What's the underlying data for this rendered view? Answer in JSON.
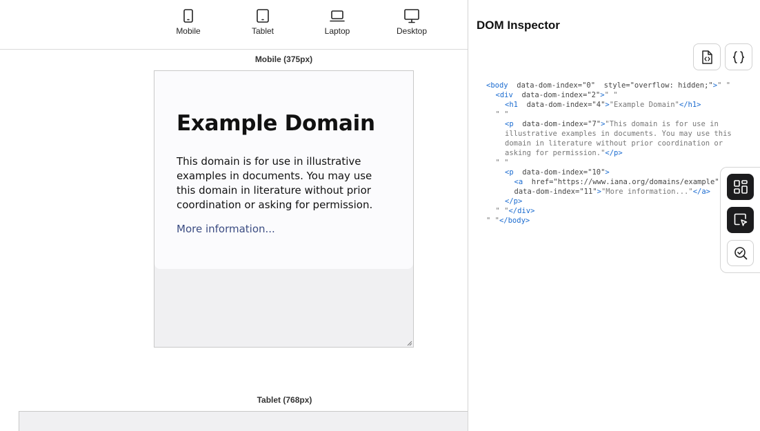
{
  "devices": [
    {
      "label": "Mobile",
      "icon": "mobile-icon"
    },
    {
      "label": "Tablet",
      "icon": "tablet-icon"
    },
    {
      "label": "Laptop",
      "icon": "laptop-icon"
    },
    {
      "label": "Desktop",
      "icon": "desktop-icon"
    }
  ],
  "preview": {
    "mobile_label": "Mobile (375px)",
    "tablet_label": "Tablet (768px)",
    "page": {
      "heading": "Example Domain",
      "body": "This domain is for use in illustrative examples in documents. You may use this domain in literature without prior coordination or asking for permission.",
      "link_text": "More information..."
    }
  },
  "inspector": {
    "title": "DOM Inspector",
    "view_source_icon": "file-code-icon",
    "json_icon": "braces-icon",
    "lines": [
      {
        "indent": 0,
        "parts": [
          [
            "tag",
            "<body"
          ],
          [
            "attr",
            "  data-dom-index=\"0\"  style=\"overflow: hidden;\""
          ],
          [
            "tag",
            ">"
          ],
          [
            "str",
            "\" \""
          ]
        ]
      },
      {
        "indent": 1,
        "parts": [
          [
            "tag",
            "<div"
          ],
          [
            "attr",
            "  data-dom-index=\"2\""
          ],
          [
            "tag",
            ">"
          ],
          [
            "str",
            "\" \""
          ]
        ]
      },
      {
        "indent": 2,
        "parts": [
          [
            "tag",
            "<h1"
          ],
          [
            "attr",
            "  data-dom-index=\"4\""
          ],
          [
            "tag",
            ">"
          ],
          [
            "str",
            "\"Example Domain\""
          ],
          [
            "tag",
            "</h1>"
          ]
        ]
      },
      {
        "indent": 1,
        "parts": [
          [
            "str",
            "\" \""
          ]
        ]
      },
      {
        "indent": 2,
        "parts": [
          [
            "tag",
            "<p"
          ],
          [
            "attr",
            "  data-dom-index=\"7\""
          ],
          [
            "tag",
            ">"
          ],
          [
            "str",
            "\"This domain is for use in"
          ]
        ]
      },
      {
        "indent": 2,
        "parts": [
          [
            "str",
            "illustrative examples in documents. You may use this"
          ]
        ]
      },
      {
        "indent": 2,
        "parts": [
          [
            "str",
            "domain in literature without prior coordination or"
          ]
        ]
      },
      {
        "indent": 2,
        "parts": [
          [
            "str",
            "asking for permission.\""
          ],
          [
            "tag",
            "</p>"
          ]
        ]
      },
      {
        "indent": 1,
        "parts": [
          [
            "str",
            "\" \""
          ]
        ]
      },
      {
        "indent": 2,
        "parts": [
          [
            "tag",
            "<p"
          ],
          [
            "attr",
            "  data-dom-index=\"10\""
          ],
          [
            "tag",
            ">"
          ]
        ]
      },
      {
        "indent": 3,
        "parts": [
          [
            "tag",
            "<a"
          ],
          [
            "attr",
            "  href=\"https://www.iana.org/domains/example\""
          ]
        ]
      },
      {
        "indent": 3,
        "parts": [
          [
            "attr",
            "data-dom-index=\"11\""
          ],
          [
            "tag",
            ">"
          ],
          [
            "str",
            "\"More information...\""
          ],
          [
            "tag",
            "</a>"
          ]
        ]
      },
      {
        "indent": 2,
        "parts": [
          [
            "tag",
            "</p>"
          ]
        ]
      },
      {
        "indent": 1,
        "parts": [
          [
            "str",
            "\" \""
          ],
          [
            "tag",
            "</div>"
          ]
        ]
      },
      {
        "indent": 0,
        "parts": [
          [
            "str",
            "\" \""
          ],
          [
            "tag",
            "</body>"
          ]
        ]
      }
    ]
  },
  "fab": [
    {
      "icon": "dashboard-icon",
      "style": "dark"
    },
    {
      "icon": "select-element-icon",
      "style": "dark"
    },
    {
      "icon": "inspect-check-icon",
      "style": "light"
    }
  ]
}
